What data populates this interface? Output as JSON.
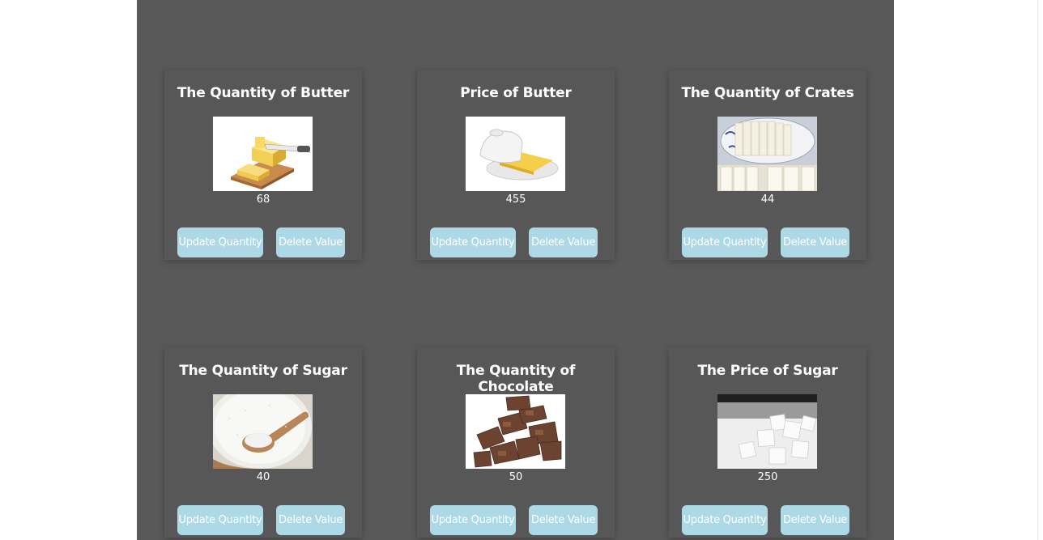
{
  "cards": [
    {
      "title": "The Quantity of Butter",
      "value": "68",
      "update_label": "Update Quantity",
      "delete_label": "Delete Value"
    },
    {
      "title": "Price of Butter",
      "value": "455",
      "update_label": "Update Quantity",
      "delete_label": "Delete Value"
    },
    {
      "title": "The Quantity of Crates",
      "value": "44",
      "update_label": "Update Quantity",
      "delete_label": "Delete Value"
    },
    {
      "title": "The Quantity of Sugar",
      "value": "40",
      "update_label": "Update Quantity",
      "delete_label": "Delete Value"
    },
    {
      "title": "The Quantity of Chocolate",
      "value": "50",
      "update_label": "Update Quantity",
      "delete_label": "Delete Value"
    },
    {
      "title": "The Price of Sugar",
      "value": "250",
      "update_label": "Update Quantity",
      "delete_label": "Delete Value"
    }
  ],
  "colors": {
    "panel_bg": "#595959",
    "card_bg": "#575757",
    "button_bg": "#add8e6",
    "text": "#ffffff"
  },
  "images": [
    "butter-block-image",
    "butter-dish-image",
    "crates-plate-image",
    "sugar-spoon-image",
    "chocolate-pieces-image",
    "sugar-cubes-image"
  ]
}
